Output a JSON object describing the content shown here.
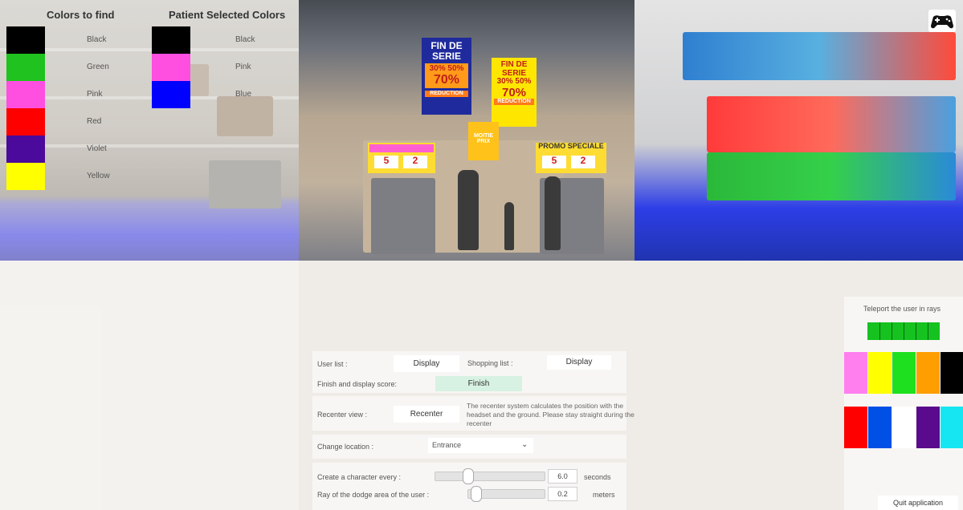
{
  "colors_to_find": {
    "title": "Colors to find",
    "items": [
      {
        "label": "Black",
        "color": "#000000"
      },
      {
        "label": "Green",
        "color": "#1fc21f"
      },
      {
        "label": "Pink",
        "color": "#ff4fe0"
      },
      {
        "label": "Red",
        "color": "#ff0000"
      },
      {
        "label": "Violet",
        "color": "#4b0a9c"
      },
      {
        "label": "Yellow",
        "color": "#ffff00"
      }
    ]
  },
  "patient_selected": {
    "title": "Patient Selected Colors",
    "items": [
      {
        "label": "Black",
        "color": "#000000"
      },
      {
        "label": "Pink",
        "color": "#ff4fe0"
      },
      {
        "label": "Blue",
        "color": "#0000ff"
      }
    ]
  },
  "scene_signs": {
    "fin_de_serie": "FIN DE SERIE",
    "percent": "30% 50%",
    "seventy": "70%",
    "reduction": "REDUCTION",
    "moitie_prix": "MOITIE PRIX",
    "promo_speciale": "PROMO SPECIALE",
    "price1": "5",
    "price2": "2"
  },
  "controls": {
    "user_list_label": "User list :",
    "user_list_button": "Display",
    "shopping_list_label": "Shopping list :",
    "shopping_list_button": "Display",
    "finish_label": "Finish and display score:",
    "finish_button": "Finish",
    "recenter_label": "Recenter view :",
    "recenter_button": "Recenter",
    "recenter_note": "The recenter system calculates the position with the headset and the ground. Please stay straight during the recenter",
    "location_label": "Change location :",
    "location_value": "Entrance",
    "character_label": "Create a character every :",
    "character_value": "6.0",
    "character_unit": "seconds",
    "character_fraction": 0.3,
    "dodge_label": "Ray of the dodge area of the user :",
    "dodge_value": "0.2",
    "dodge_unit": "meters",
    "dodge_fraction": 0.1
  },
  "teleport": {
    "title": "Teleport the user in rays",
    "progress_segments": 6,
    "row1": [
      "#ff7fef",
      "#ffff00",
      "#1fe01f",
      "#ff9e00",
      "#000000"
    ],
    "row2": [
      "#ff0000",
      "#0050e6",
      "#ffffff",
      "#5a0a8c",
      "#16e6f2"
    ]
  },
  "quit_label": "Quit application",
  "gamepad_icon": "gamepad-icon"
}
